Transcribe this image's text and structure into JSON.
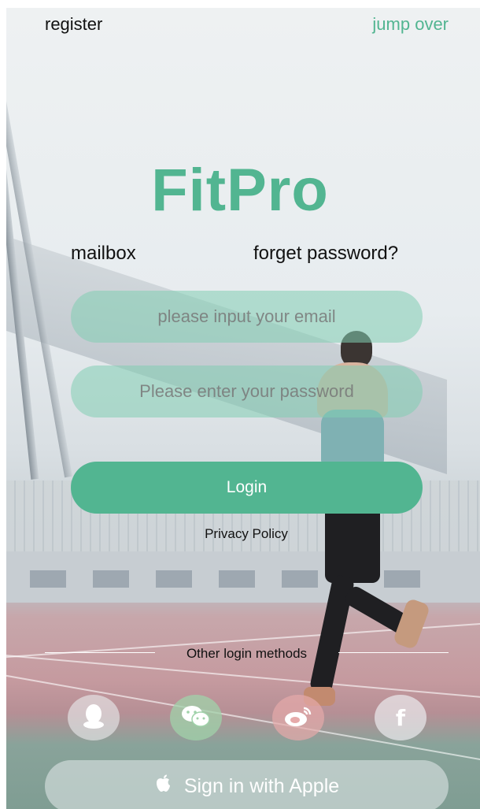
{
  "top": {
    "register_label": "register",
    "skip_label": "jump over"
  },
  "logo": {
    "text": "FitPro"
  },
  "labels": {
    "mailbox": "mailbox",
    "forget_password": "forget password?"
  },
  "fields": {
    "email_placeholder": "please input your email",
    "password_placeholder": "Please enter your password"
  },
  "buttons": {
    "login": "Login",
    "apple": "Sign in with Apple"
  },
  "links": {
    "privacy": "Privacy Policy"
  },
  "other_methods": {
    "label": "Other login methods",
    "icons": [
      "qq-icon",
      "wechat-icon",
      "weibo-icon",
      "facebook-icon"
    ]
  },
  "colors": {
    "accent": "#52b591",
    "input_fill": "#82ceb2"
  }
}
